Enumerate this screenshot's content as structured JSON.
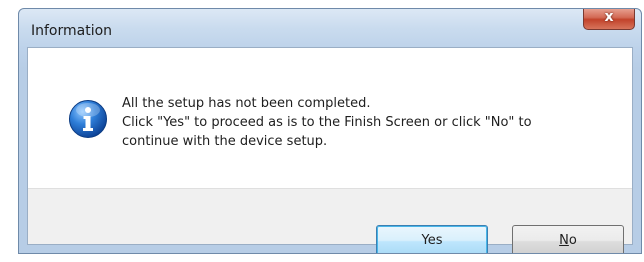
{
  "window": {
    "title": "Information",
    "close_glyph": "x"
  },
  "message": {
    "icon": "info-icon",
    "line1": "All the setup has not been completed.",
    "line2": "Click \"Yes\" to proceed as is to the Finish Screen or click \"No\" to",
    "line3": "continue with the device setup."
  },
  "buttons": {
    "yes_label": "Yes",
    "no_mnemonic": "N",
    "no_rest": "o"
  },
  "colors": {
    "frame": "#b7cde6",
    "close_button": "#c2432b",
    "default_button_border": "#3c7fb1",
    "button_bar": "#f0f0f0"
  }
}
